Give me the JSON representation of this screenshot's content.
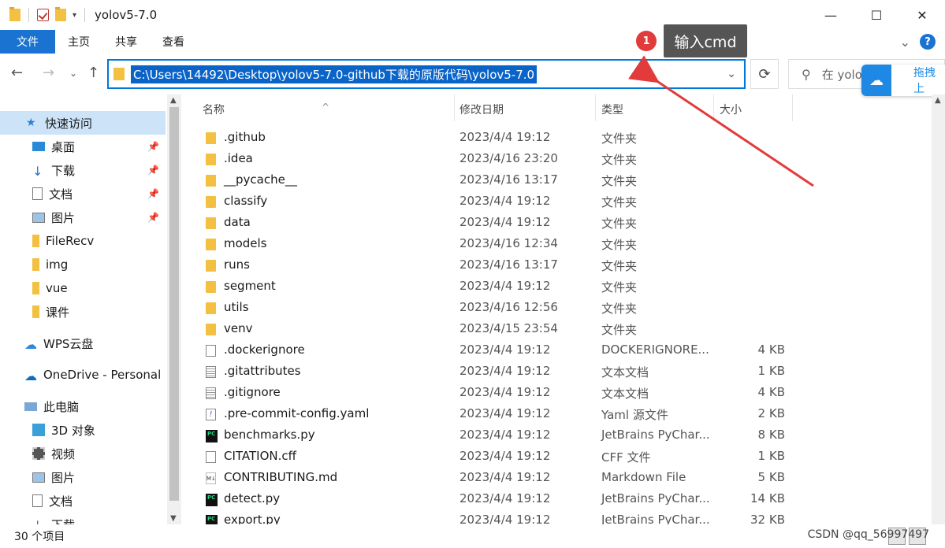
{
  "window": {
    "title": "yolov5-7.0",
    "minimize": "—",
    "maximize": "☐",
    "close": "✕"
  },
  "ribbon": {
    "tabs": [
      "文件",
      "主页",
      "共享",
      "查看"
    ],
    "expand": "⌄",
    "help": "?"
  },
  "annotation": {
    "number": "1",
    "text": "输入cmd",
    "color": "#e23b3b"
  },
  "address": {
    "path": "C:\\Users\\14492\\Desktop\\yolov5-7.0-github下载的原版代码\\yolov5-7.0",
    "search_placeholder": "在 yolo"
  },
  "cloud_popup": {
    "label": "拖拽上"
  },
  "sidebar": {
    "items": [
      {
        "label": "快速访问",
        "icon": "star-icon",
        "pinned": false,
        "selected": true
      },
      {
        "label": "桌面",
        "icon": "desktop-icon",
        "pinned": true
      },
      {
        "label": "下载",
        "icon": "download-icon",
        "pinned": true
      },
      {
        "label": "文档",
        "icon": "document-icon",
        "pinned": true
      },
      {
        "label": "图片",
        "icon": "picture-icon",
        "pinned": true
      },
      {
        "label": "FileRecv",
        "icon": "folder-icon",
        "pinned": false
      },
      {
        "label": "img",
        "icon": "folder-icon",
        "pinned": false
      },
      {
        "label": "vue",
        "icon": "folder-icon",
        "pinned": false
      },
      {
        "label": "课件",
        "icon": "folder-icon",
        "pinned": false
      },
      {
        "label": "WPS云盘",
        "icon": "cloud-icon",
        "pinned": false
      },
      {
        "label": "OneDrive - Personal",
        "icon": "onedrive-icon",
        "pinned": false
      },
      {
        "label": "此电脑",
        "icon": "computer-icon",
        "pinned": false
      },
      {
        "label": "3D 对象",
        "icon": "3d-objects-icon",
        "pinned": false
      },
      {
        "label": "视频",
        "icon": "video-icon",
        "pinned": false
      },
      {
        "label": "图片",
        "icon": "picture-icon",
        "pinned": false
      },
      {
        "label": "文档",
        "icon": "document-icon",
        "pinned": false
      },
      {
        "label": "下载",
        "icon": "download-icon",
        "pinned": false
      }
    ]
  },
  "columns": {
    "name": "名称",
    "date": "修改日期",
    "type": "类型",
    "size": "大小"
  },
  "files": [
    {
      "name": ".github",
      "date": "2023/4/4 19:12",
      "type": "文件夹",
      "size": "",
      "icon": "folder"
    },
    {
      "name": ".idea",
      "date": "2023/4/16 23:20",
      "type": "文件夹",
      "size": "",
      "icon": "folder"
    },
    {
      "name": "__pycache__",
      "date": "2023/4/16 13:17",
      "type": "文件夹",
      "size": "",
      "icon": "folder"
    },
    {
      "name": "classify",
      "date": "2023/4/4 19:12",
      "type": "文件夹",
      "size": "",
      "icon": "folder"
    },
    {
      "name": "data",
      "date": "2023/4/4 19:12",
      "type": "文件夹",
      "size": "",
      "icon": "folder"
    },
    {
      "name": "models",
      "date": "2023/4/16 12:34",
      "type": "文件夹",
      "size": "",
      "icon": "folder"
    },
    {
      "name": "runs",
      "date": "2023/4/16 13:17",
      "type": "文件夹",
      "size": "",
      "icon": "folder"
    },
    {
      "name": "segment",
      "date": "2023/4/4 19:12",
      "type": "文件夹",
      "size": "",
      "icon": "folder"
    },
    {
      "name": "utils",
      "date": "2023/4/16 12:56",
      "type": "文件夹",
      "size": "",
      "icon": "folder"
    },
    {
      "name": "venv",
      "date": "2023/4/15 23:54",
      "type": "文件夹",
      "size": "",
      "icon": "folder"
    },
    {
      "name": ".dockerignore",
      "date": "2023/4/4 19:12",
      "type": "DOCKERIGNORE...",
      "size": "4 KB",
      "icon": "file"
    },
    {
      "name": ".gitattributes",
      "date": "2023/4/4 19:12",
      "type": "文本文档",
      "size": "1 KB",
      "icon": "text"
    },
    {
      "name": ".gitignore",
      "date": "2023/4/4 19:12",
      "type": "文本文档",
      "size": "4 KB",
      "icon": "text"
    },
    {
      "name": ".pre-commit-config.yaml",
      "date": "2023/4/4 19:12",
      "type": "Yaml 源文件",
      "size": "2 KB",
      "icon": "yaml"
    },
    {
      "name": "benchmarks.py",
      "date": "2023/4/4 19:12",
      "type": "JetBrains PyChar...",
      "size": "8 KB",
      "icon": "pycharm"
    },
    {
      "name": "CITATION.cff",
      "date": "2023/4/4 19:12",
      "type": "CFF 文件",
      "size": "1 KB",
      "icon": "file"
    },
    {
      "name": "CONTRIBUTING.md",
      "date": "2023/4/4 19:12",
      "type": "Markdown File",
      "size": "5 KB",
      "icon": "markdown"
    },
    {
      "name": "detect.py",
      "date": "2023/4/4 19:12",
      "type": "JetBrains PyChar...",
      "size": "14 KB",
      "icon": "pycharm"
    },
    {
      "name": "export.py",
      "date": "2023/4/4 19:12",
      "type": "JetBrains PyChar...",
      "size": "32 KB",
      "icon": "pycharm"
    }
  ],
  "status": {
    "count": "30 个项目",
    "watermark": "CSDN @qq_56997497"
  }
}
